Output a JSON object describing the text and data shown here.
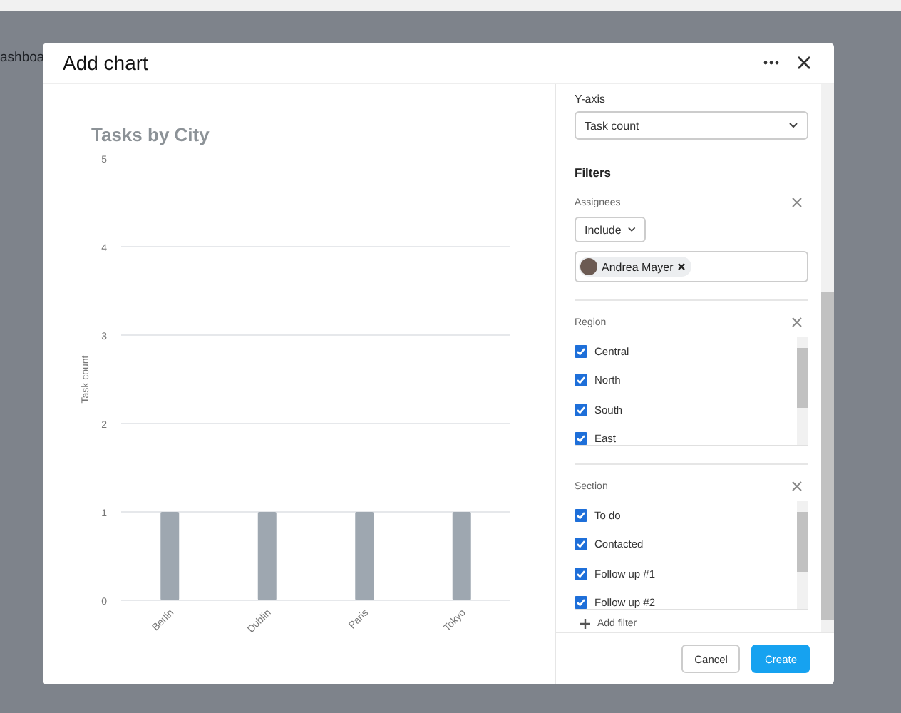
{
  "background": {
    "page_title": "ashboa"
  },
  "dialog": {
    "title": "Add chart"
  },
  "chart": {
    "chart_data": {
      "type": "bar",
      "title": "Tasks by City",
      "ylabel": "Task count",
      "categories": [
        "Berlin",
        "Dublin",
        "Paris",
        "Tokyo"
      ],
      "values": [
        1,
        1,
        1,
        1
      ],
      "grid": true,
      "ylim": [
        0,
        5
      ],
      "yticks": [
        0,
        1,
        2,
        3,
        4,
        5
      ]
    }
  },
  "settings": {
    "y_axis": {
      "label": "Y-axis",
      "value": "Task count"
    },
    "filters_heading": "Filters",
    "filters": [
      {
        "kind": "people",
        "label": "Assignees",
        "mode": "Include",
        "people": [
          {
            "name": "Andrea Mayer"
          }
        ]
      },
      {
        "kind": "checklist",
        "label": "Region",
        "options": [
          {
            "label": "Central",
            "checked": true
          },
          {
            "label": "North",
            "checked": true
          },
          {
            "label": "South",
            "checked": true
          },
          {
            "label": "East",
            "checked": true
          }
        ]
      },
      {
        "kind": "checklist",
        "label": "Section",
        "options": [
          {
            "label": "To do",
            "checked": true
          },
          {
            "label": "Contacted",
            "checked": true
          },
          {
            "label": "Follow up #1",
            "checked": true
          },
          {
            "label": "Follow up #2",
            "checked": true
          }
        ]
      }
    ],
    "add_filter": "Add filter"
  },
  "buttons": [
    {
      "label": "Cancel",
      "kind": "secondary"
    },
    {
      "label": "Create",
      "kind": "primary"
    }
  ]
}
